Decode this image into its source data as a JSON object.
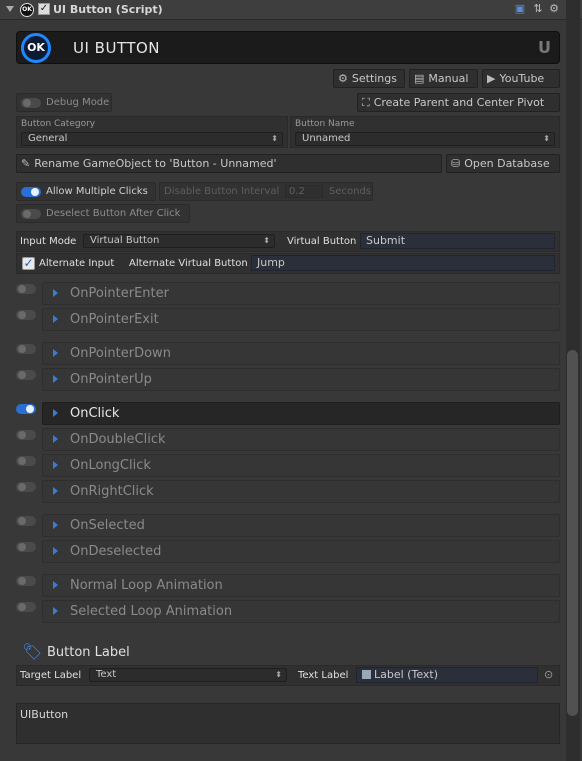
{
  "header": {
    "title": "UI Button (Script)"
  },
  "banner": {
    "title": "UI BUTTON",
    "badge": "OK"
  },
  "links": {
    "settings": "Settings",
    "manual": "Manual",
    "youtube": "YouTube"
  },
  "debug": {
    "label": "Debug Mode",
    "enabled": false
  },
  "create_parent": "Create Parent and Center Pivot",
  "category": {
    "label": "Button Category",
    "value": "General"
  },
  "name": {
    "label": "Button Name",
    "value": "Unnamed"
  },
  "rename": "Rename GameObject to 'Button - Unnamed'",
  "open_db": "Open Database",
  "multi_click": {
    "label": "Allow Multiple Clicks",
    "enabled": true
  },
  "disable_interval": {
    "label": "Disable Button Interval",
    "value": "0.2",
    "unit": "Seconds"
  },
  "deselect": {
    "label": "Deselect Button After Click",
    "enabled": false
  },
  "input": {
    "mode_label": "Input Mode",
    "mode_value": "Virtual Button",
    "vb_label": "Virtual Button",
    "vb_value": "Submit",
    "alt_label": "Alternate Input",
    "alt_checked": true,
    "alt_vb_label": "Alternate Virtual Button",
    "alt_vb_value": "Jump"
  },
  "events": [
    {
      "label": "OnPointerEnter",
      "enabled": false
    },
    {
      "label": "OnPointerExit",
      "enabled": false
    },
    {
      "label": "OnPointerDown",
      "enabled": false
    },
    {
      "label": "OnPointerUp",
      "enabled": false
    },
    {
      "label": "OnClick",
      "enabled": true
    },
    {
      "label": "OnDoubleClick",
      "enabled": false
    },
    {
      "label": "OnLongClick",
      "enabled": false
    },
    {
      "label": "OnRightClick",
      "enabled": false
    },
    {
      "label": "OnSelected",
      "enabled": false
    },
    {
      "label": "OnDeselected",
      "enabled": false
    },
    {
      "label": "Normal Loop Animation",
      "enabled": false
    },
    {
      "label": "Selected Loop Animation",
      "enabled": false
    }
  ],
  "button_label": {
    "title": "Button Label",
    "target_label": "Target Label",
    "target_value": "Text",
    "text_label": "Text Label",
    "text_value": "Label (Text)"
  },
  "preview": {
    "text": "UIButton"
  },
  "colors": {
    "accent": "#1e88ff",
    "toggle_on": "#2a6fd6",
    "panel": "#383838"
  }
}
